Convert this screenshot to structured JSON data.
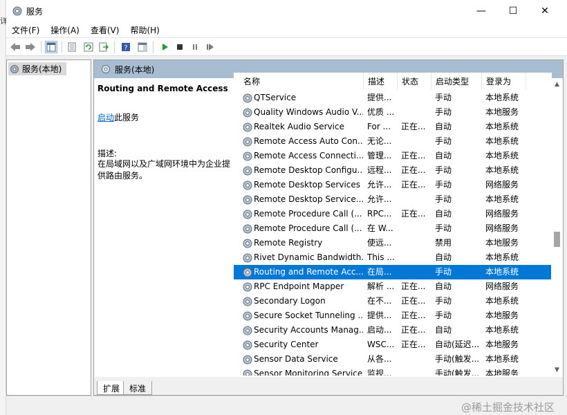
{
  "window": {
    "title": "服务",
    "controls": {
      "minimize": "—",
      "maximize": "☐",
      "close": "✕"
    }
  },
  "background_window": {
    "edge_text": "详"
  },
  "menu": [
    "文件(F)",
    "操作(A)",
    "查看(V)",
    "帮助(H)"
  ],
  "toolbar": [
    "back-icon",
    "forward-icon",
    "show-hide-tree-icon",
    "properties-icon",
    "refresh-icon",
    "export-list-icon",
    "help-icon",
    "show-hide-action-pane-icon",
    "start-service-icon",
    "stop-service-icon",
    "pause-service-icon",
    "restart-service-icon"
  ],
  "tree": {
    "item": "服务(本地)"
  },
  "panel": {
    "header": "服务(本地)"
  },
  "description": {
    "title": "Routing and Remote Access",
    "start_link": "启动",
    "start_suffix": "此服务",
    "label": "描述:",
    "text": "在局域网以及广域网环境中为企业提供路由服务。"
  },
  "columns": {
    "name": "名称",
    "desc": "描述",
    "status": "状态",
    "startup": "启动类型",
    "logon": "登录为"
  },
  "services": [
    {
      "name": "QTService",
      "desc": "提供...",
      "status": "",
      "startup": "手动",
      "logon": "本地系统"
    },
    {
      "name": "Quality Windows Audio V...",
      "desc": "优质 ...",
      "status": "",
      "startup": "手动",
      "logon": "本地服务"
    },
    {
      "name": "Realtek Audio Service",
      "desc": "For ...",
      "status": "正在...",
      "startup": "自动",
      "logon": "本地系统"
    },
    {
      "name": "Remote Access Auto Con...",
      "desc": "无论...",
      "status": "",
      "startup": "手动",
      "logon": "本地系统"
    },
    {
      "name": "Remote Access Connecti...",
      "desc": "管理...",
      "status": "正在...",
      "startup": "自动",
      "logon": "本地系统"
    },
    {
      "name": "Remote Desktop Configu...",
      "desc": "远程...",
      "status": "正在...",
      "startup": "手动",
      "logon": "本地系统"
    },
    {
      "name": "Remote Desktop Services",
      "desc": "允许...",
      "status": "正在...",
      "startup": "手动",
      "logon": "网络服务"
    },
    {
      "name": "Remote Desktop Service...",
      "desc": "允许...",
      "status": "",
      "startup": "手动",
      "logon": "本地系统"
    },
    {
      "name": "Remote Procedure Call (...",
      "desc": "RPC...",
      "status": "正在...",
      "startup": "自动",
      "logon": "网络服务"
    },
    {
      "name": "Remote Procedure Call (...",
      "desc": "在 W...",
      "status": "",
      "startup": "手动",
      "logon": "网络服务"
    },
    {
      "name": "Remote Registry",
      "desc": "使远...",
      "status": "",
      "startup": "禁用",
      "logon": "本地服务"
    },
    {
      "name": "Rivet Dynamic Bandwidth...",
      "desc": "This ...",
      "status": "",
      "startup": "自动",
      "logon": "本地系统"
    },
    {
      "name": "Routing and Remote Acc...",
      "desc": "在局...",
      "status": "",
      "startup": "手动",
      "logon": "本地系统",
      "selected": true
    },
    {
      "name": "RPC Endpoint Mapper",
      "desc": "解析 ...",
      "status": "正在...",
      "startup": "自动",
      "logon": "网络服务"
    },
    {
      "name": "Secondary Logon",
      "desc": "在不...",
      "status": "正在...",
      "startup": "手动",
      "logon": "本地系统"
    },
    {
      "name": "Secure Socket Tunneling ...",
      "desc": "提供...",
      "status": "正在...",
      "startup": "手动",
      "logon": "本地服务"
    },
    {
      "name": "Security Accounts Manag...",
      "desc": "启动...",
      "status": "正在...",
      "startup": "自动",
      "logon": "本地系统"
    },
    {
      "name": "Security Center",
      "desc": "WSC...",
      "status": "正在...",
      "startup": "自动(延迟...",
      "logon": "本地服务"
    },
    {
      "name": "Sensor Data Service",
      "desc": "从各...",
      "status": "",
      "startup": "手动(触发...",
      "logon": "本地系统"
    },
    {
      "name": "Sensor Monitoring Service",
      "desc": "监视...",
      "status": "",
      "startup": "手动(触发...",
      "logon": "本地服务"
    }
  ],
  "tabs": [
    "扩展",
    "标准"
  ],
  "watermark": "@稀土掘金技术社区"
}
